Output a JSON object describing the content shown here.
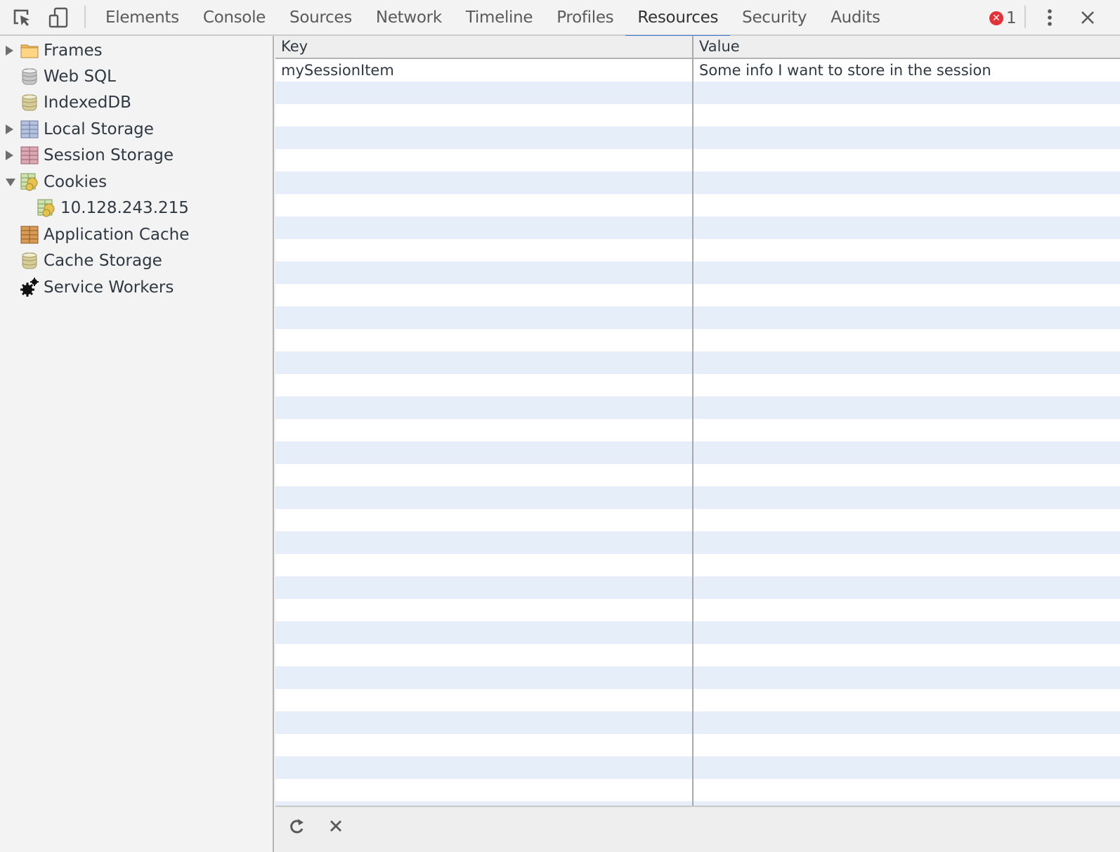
{
  "toolbar": {
    "inspect_icon": "inspect-element-icon",
    "device_icon": "device-mode-icon",
    "tabs": [
      {
        "label": "Elements",
        "active": false
      },
      {
        "label": "Console",
        "active": false
      },
      {
        "label": "Sources",
        "active": false
      },
      {
        "label": "Network",
        "active": false
      },
      {
        "label": "Timeline",
        "active": false
      },
      {
        "label": "Profiles",
        "active": false
      },
      {
        "label": "Resources",
        "active": true
      },
      {
        "label": "Security",
        "active": false
      },
      {
        "label": "Audits",
        "active": false
      }
    ],
    "error_count": "1",
    "menu_icon": "more-vertical-icon",
    "close_icon": "close-icon",
    "accent_color": "#3879d9",
    "error_color": "#e2333a"
  },
  "sidebar": {
    "items": [
      {
        "label": "Frames",
        "icon": "folder-icon",
        "expandable": true,
        "expanded": false,
        "level": 0
      },
      {
        "label": "Web SQL",
        "icon": "database-icon",
        "expandable": false,
        "level": 0
      },
      {
        "label": "IndexedDB",
        "icon": "database-icon",
        "expandable": false,
        "level": 0
      },
      {
        "label": "Local Storage",
        "icon": "table-icon",
        "expandable": true,
        "expanded": false,
        "level": 0
      },
      {
        "label": "Session Storage",
        "icon": "table-icon",
        "expandable": true,
        "expanded": false,
        "level": 0
      },
      {
        "label": "Cookies",
        "icon": "cookie-icon",
        "expandable": true,
        "expanded": true,
        "level": 0
      },
      {
        "label": "10.128.243.215",
        "icon": "cookie-icon",
        "expandable": false,
        "level": 1
      },
      {
        "label": "Application Cache",
        "icon": "table-icon",
        "expandable": false,
        "level": 0
      },
      {
        "label": "Cache Storage",
        "icon": "database-icon",
        "expandable": false,
        "level": 0
      },
      {
        "label": "Service Workers",
        "icon": "gears-icon",
        "expandable": false,
        "level": 0
      }
    ]
  },
  "grid": {
    "columns": [
      "Key",
      "Value"
    ],
    "rows": [
      {
        "key": "mySessionItem",
        "value": "Some info I want to store in the session"
      }
    ],
    "stripe_color": "#e6eef9"
  },
  "footer": {
    "refresh_icon": "refresh-icon",
    "delete_icon": "delete-icon"
  }
}
